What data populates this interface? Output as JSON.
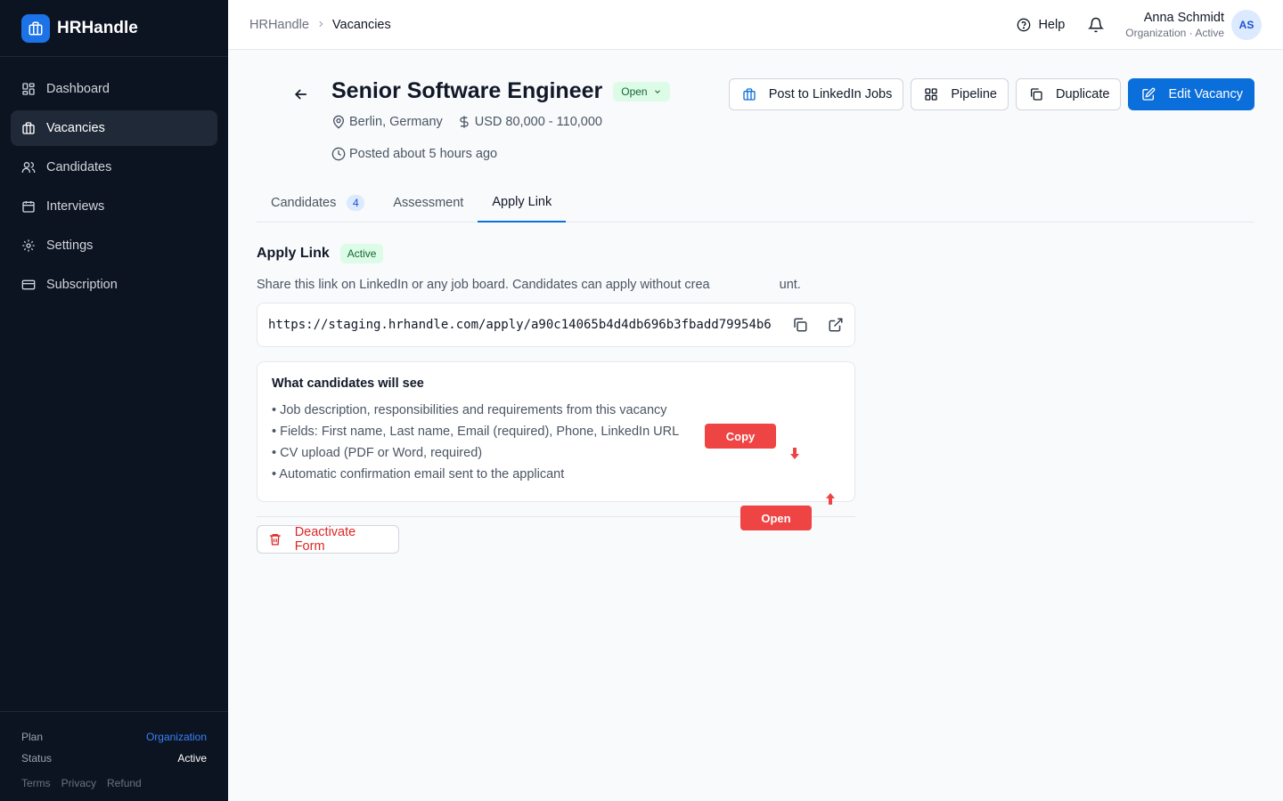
{
  "brand": {
    "name": "HRHandle"
  },
  "sidebar": {
    "items": [
      {
        "label": "Dashboard",
        "icon": "dashboard-icon",
        "active": false
      },
      {
        "label": "Vacancies",
        "icon": "briefcase-icon",
        "active": true
      },
      {
        "label": "Candidates",
        "icon": "users-icon",
        "active": false
      },
      {
        "label": "Interviews",
        "icon": "calendar-icon",
        "active": false
      },
      {
        "label": "Settings",
        "icon": "gear-icon",
        "active": false
      },
      {
        "label": "Subscription",
        "icon": "credit-card-icon",
        "active": false
      }
    ],
    "footer": {
      "plan_label": "Plan",
      "plan_value": "Organization",
      "status_label": "Status",
      "status_value": "Active",
      "links": [
        "Terms",
        "Privacy",
        "Refund"
      ]
    }
  },
  "topbar": {
    "breadcrumb": {
      "home": "HRHandle",
      "separator": ">",
      "current": "Vacancies"
    },
    "help_label": "Help",
    "user": {
      "name": "Anna Schmidt",
      "org": "Organization · Active",
      "initials": "AS"
    }
  },
  "vacancy": {
    "title": "Senior Software Engineer",
    "status": "Open",
    "location": "Berlin, Germany",
    "salary": "USD 80,000 - 110,000",
    "posted": "Posted about 5 hours ago"
  },
  "actions": {
    "linkedin": "Post to LinkedIn Jobs",
    "pipeline": "Pipeline",
    "duplicate": "Duplicate",
    "edit": "Edit Vacancy"
  },
  "tabs": [
    {
      "label": "Candidates",
      "count": "4",
      "active": false
    },
    {
      "label": "Assessment",
      "active": false
    },
    {
      "label": "Apply Link",
      "active": true
    }
  ],
  "apply_link": {
    "title": "Apply Link",
    "badge": "Active",
    "description": "Share this link on LinkedIn or any job board. Candidates can apply without crea",
    "description_tail": "unt.",
    "url": "https://staging.hrhandle.com/apply/a90c14065b4d4db696b3fbadd79954b6",
    "preview": {
      "title": "What candidates will see",
      "items": [
        "• Job description, responsibilities and requirements from this vacancy",
        "• Fields: First name, Last name, Email (required), Phone, LinkedIn URL",
        "• CV upload (PDF or Word, required)",
        "• Automatic confirmation email sent to the applicant"
      ]
    },
    "deactivate_label": "Deactivate Form"
  },
  "annotations": {
    "copy": "Copy",
    "open": "Open"
  },
  "colors": {
    "sidebar_bg": "#0c1321",
    "primary": "#0b6fdb",
    "success_bg": "#dcfce7",
    "danger": "#dc2626",
    "callout": "#ef4444"
  }
}
